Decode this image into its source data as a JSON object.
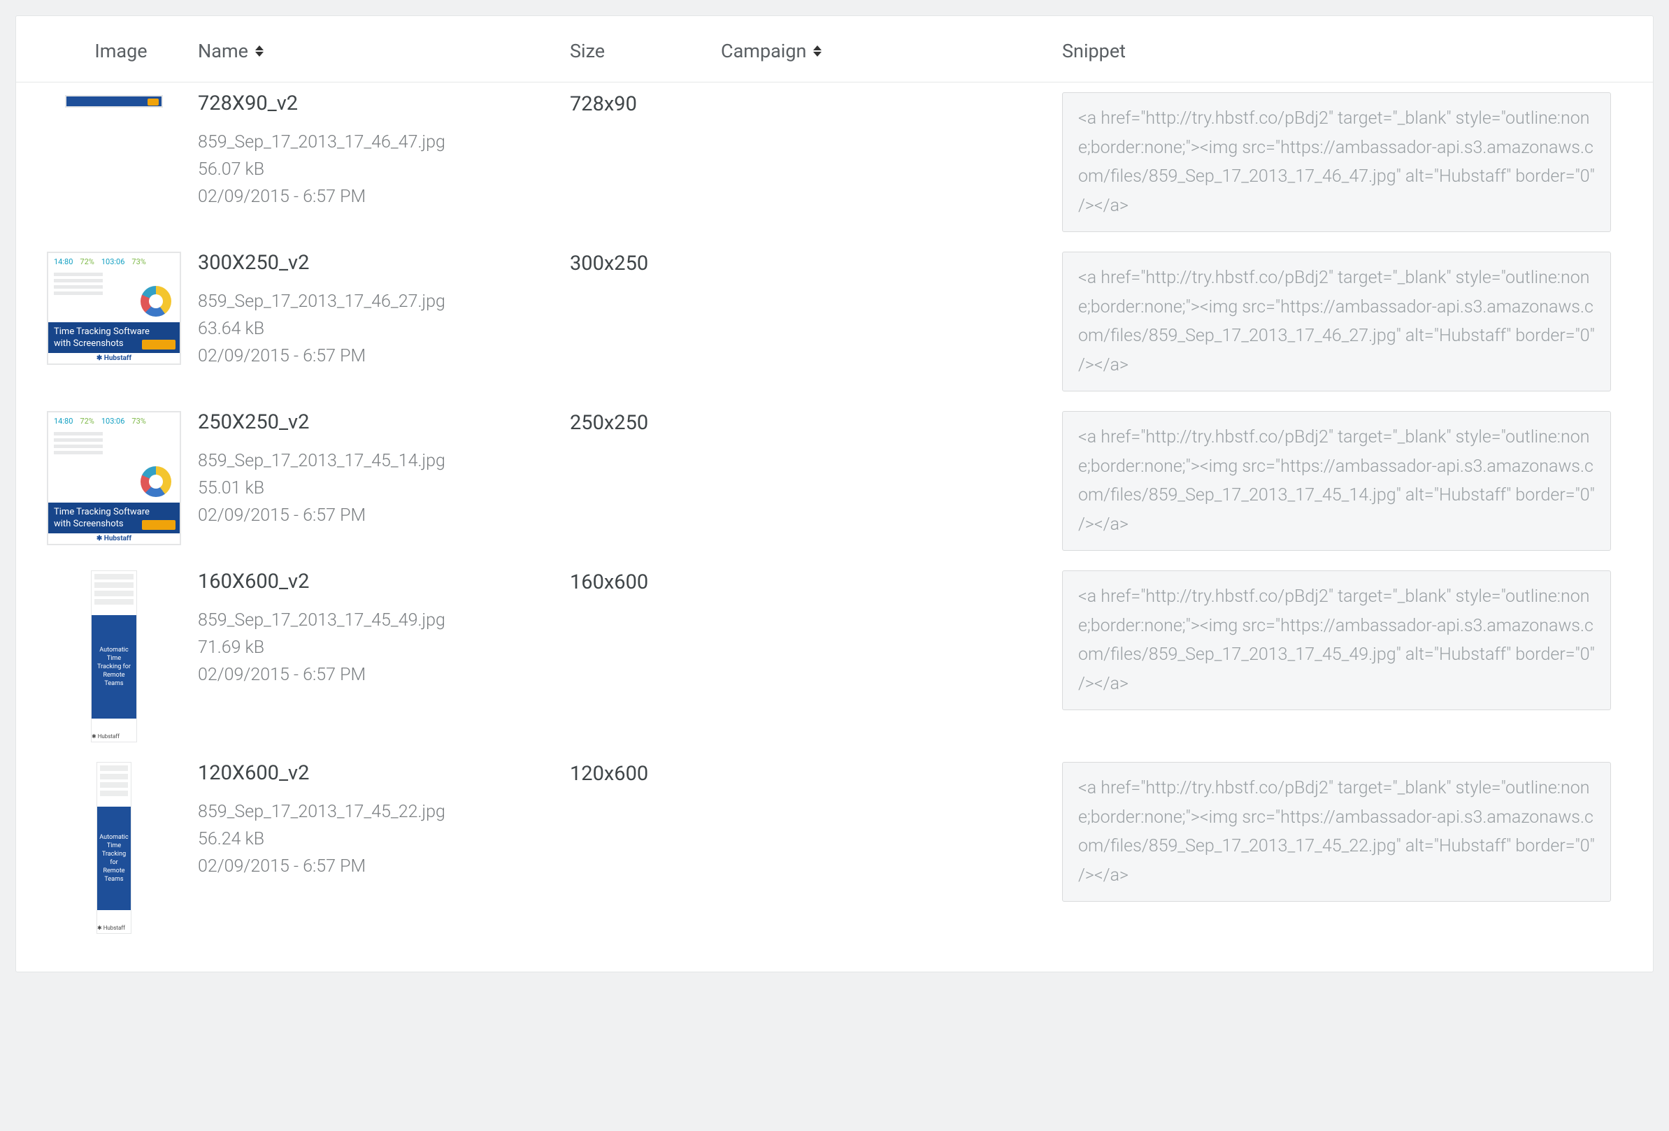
{
  "columns": {
    "image": "Image",
    "name": "Name",
    "size": "Size",
    "campaign": "Campaign",
    "snippet": "Snippet"
  },
  "rows": [
    {
      "name": "728X90_v2",
      "filename": "859_Sep_17_2013_17_46_47.jpg",
      "filesize": "56.07 kB",
      "datetime": "02/09/2015 - 6:57 PM",
      "size": "728x90",
      "campaign": "",
      "snippet": "<a href=\"http://try.hbstf.co/pBdj2\" target=\"_blank\" style=\"outline:none;border:none;\"><img src=\"https://ambassador-api.s3.amazonaws.com/files/859_Sep_17_2013_17_46_47.jpg\" alt=\"Hubstaff\" border=\"0\" /></a>"
    },
    {
      "name": "300X250_v2",
      "filename": "859_Sep_17_2013_17_46_27.jpg",
      "filesize": "63.64 kB",
      "datetime": "02/09/2015 - 6:57 PM",
      "size": "300x250",
      "campaign": "",
      "snippet": "<a href=\"http://try.hbstf.co/pBdj2\" target=\"_blank\" style=\"outline:none;border:none;\"><img src=\"https://ambassador-api.s3.amazonaws.com/files/859_Sep_17_2013_17_46_27.jpg\" alt=\"Hubstaff\" border=\"0\" /></a>"
    },
    {
      "name": "250X250_v2",
      "filename": "859_Sep_17_2013_17_45_14.jpg",
      "filesize": "55.01 kB",
      "datetime": "02/09/2015 - 6:57 PM",
      "size": "250x250",
      "campaign": "",
      "snippet": "<a href=\"http://try.hbstf.co/pBdj2\" target=\"_blank\" style=\"outline:none;border:none;\"><img src=\"https://ambassador-api.s3.amazonaws.com/files/859_Sep_17_2013_17_45_14.jpg\" alt=\"Hubstaff\" border=\"0\" /></a>"
    },
    {
      "name": "160X600_v2",
      "filename": "859_Sep_17_2013_17_45_49.jpg",
      "filesize": "71.69 kB",
      "datetime": "02/09/2015 - 6:57 PM",
      "size": "160x600",
      "campaign": "",
      "snippet": "<a href=\"http://try.hbstf.co/pBdj2\" target=\"_blank\" style=\"outline:none;border:none;\"><img src=\"https://ambassador-api.s3.amazonaws.com/files/859_Sep_17_2013_17_45_49.jpg\" alt=\"Hubstaff\" border=\"0\" /></a>"
    },
    {
      "name": "120X600_v2",
      "filename": "859_Sep_17_2013_17_45_22.jpg",
      "filesize": "56.24 kB",
      "datetime": "02/09/2015 - 6:57 PM",
      "size": "120x600",
      "campaign": "",
      "snippet": "<a href=\"http://try.hbstf.co/pBdj2\" target=\"_blank\" style=\"outline:none;border:none;\"><img src=\"https://ambassador-api.s3.amazonaws.com/files/859_Sep_17_2013_17_45_22.jpg\" alt=\"Hubstaff\" border=\"0\" /></a>"
    }
  ]
}
